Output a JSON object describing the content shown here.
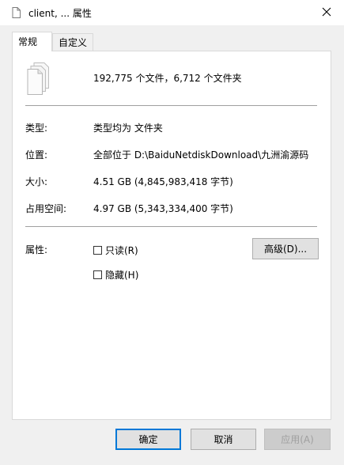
{
  "window": {
    "title": "client, ... 属性",
    "close_icon": "close-icon"
  },
  "tabs": [
    {
      "label": "常规",
      "active": true
    },
    {
      "label": "自定义",
      "active": false
    }
  ],
  "general": {
    "summary": "192,775 个文件，6,712 个文件夹",
    "type_label": "类型:",
    "type_value": "类型均为 文件夹",
    "location_label": "位置:",
    "location_value": "全部位于 D:\\BaiduNetdiskDownload\\九洲渝源码",
    "size_label": "大小:",
    "size_value": "4.51 GB (4,845,983,418 字节)",
    "disk_size_label": "占用空间:",
    "disk_size_value": "4.97 GB (5,343,334,400 字节)",
    "attributes_label": "属性:",
    "readonly_label": "只读(R)",
    "hidden_label": "隐藏(H)",
    "advanced_label": "高级(D)..."
  },
  "footer": {
    "ok_label": "确定",
    "cancel_label": "取消",
    "apply_label": "应用(A)"
  },
  "colors": {
    "background": "#f0f0f0",
    "panel": "#ffffff",
    "accent": "#0078d7",
    "disabled_text": "#a0a0a0"
  }
}
